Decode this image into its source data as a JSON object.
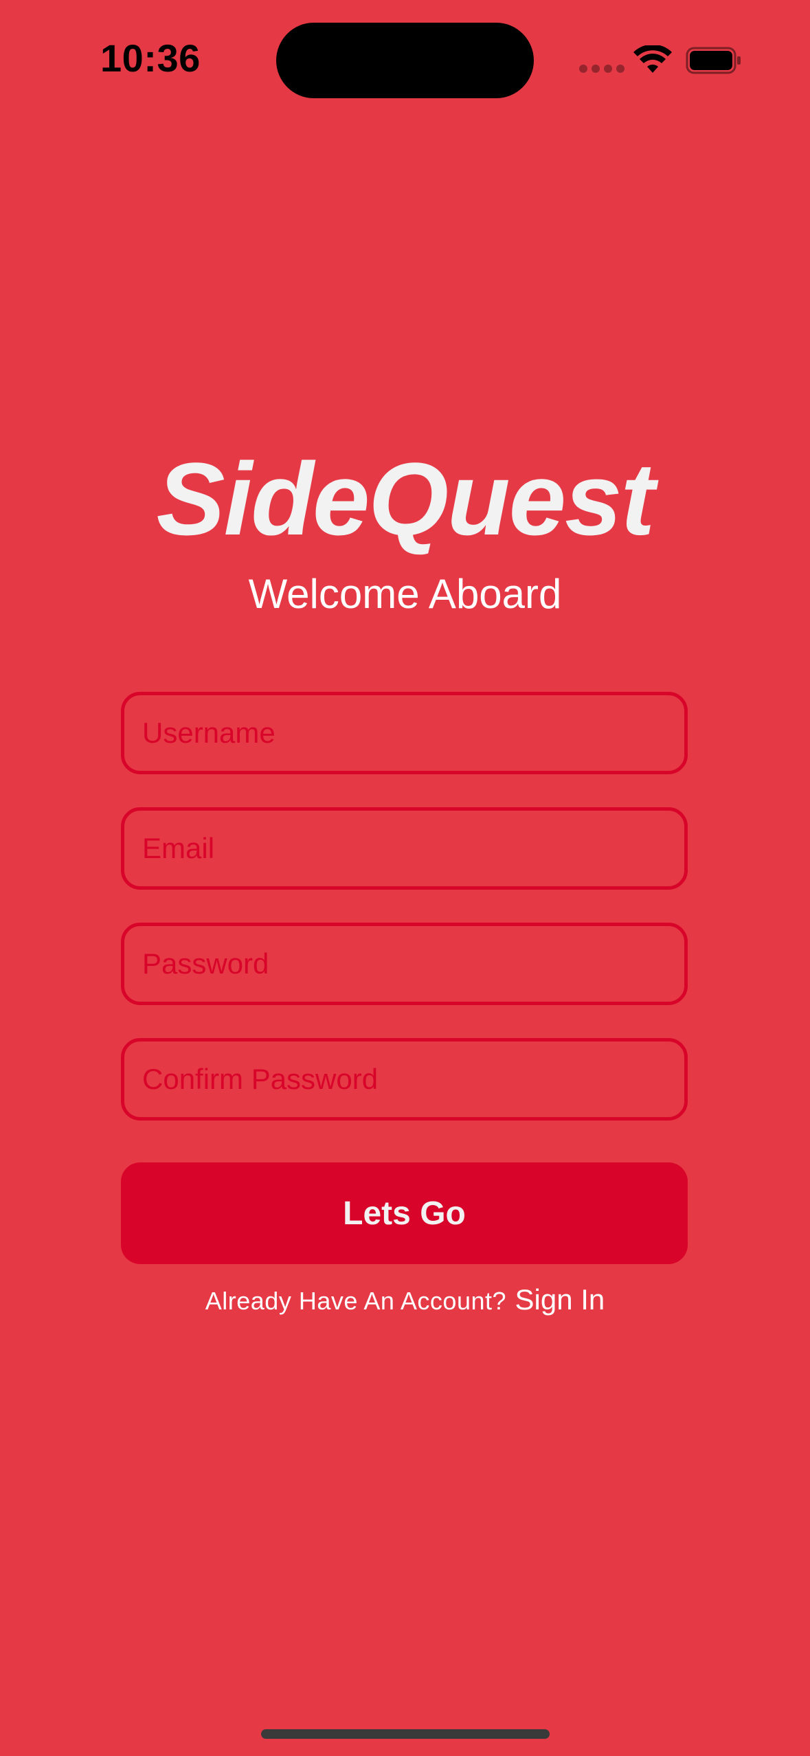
{
  "status_bar": {
    "time": "10:36"
  },
  "app": {
    "title": "SideQuest",
    "subtitle": "Welcome Aboard"
  },
  "form": {
    "username_placeholder": "Username",
    "email_placeholder": "Email",
    "password_placeholder": "Password",
    "confirm_password_placeholder": "Confirm Password",
    "submit_label": "Lets Go"
  },
  "footer": {
    "prompt": "Already Have An Account?",
    "signin_label": "Sign In"
  },
  "colors": {
    "background": "#E63946",
    "accent": "#D90429",
    "text_light": "#F2F2F2"
  },
  "icons": [
    "cellular-signal-icon",
    "wifi-icon",
    "battery-icon"
  ]
}
